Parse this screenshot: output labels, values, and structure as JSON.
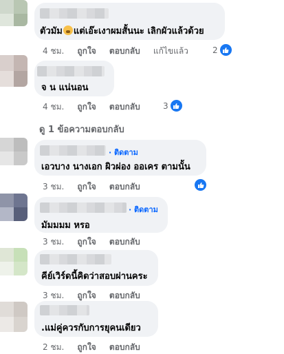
{
  "comments": [
    {
      "text_before": "ตัวมัม",
      "text_after": "แต่เอ๊ะเงาผมสั้นนะ เลิกผัวแล้วด้วย",
      "time": "4 ชม.",
      "like": "ถูกใจ",
      "reply": "ตอบกลับ",
      "edited": "แก้ไขแล้ว",
      "reactions": "2"
    },
    {
      "text": "จ น แน่นอน",
      "time": "4 ชม.",
      "like": "ถูกใจ",
      "reply": "ตอบกลับ",
      "reactions": "3"
    },
    {
      "follow": "· ติดตาม",
      "text": "เอวบาง นางเอก ผิวผ่อง ออเคร ตามนั้น",
      "time": "3 ชม.",
      "like": "ถูกใจ",
      "reply": "ตอบกลับ"
    },
    {
      "follow": "· ติดตาม",
      "text": "มัมมมม หรอ",
      "time": "3 ชม.",
      "like": "ถูกใจ",
      "reply": "ตอบกลับ"
    },
    {
      "text": "คีย์เวิร์ดนี้คิดว่าสอบผ่านคระ",
      "time": "3 ชม.",
      "like": "ถูกใจ",
      "reply": "ตอบกลับ"
    },
    {
      "text": ".แม่คู่ควรกับการยุคนเดียว",
      "time": "2 ชม.",
      "like": "ถูกใจ",
      "reply": "ตอบกลับ"
    }
  ],
  "view_replies": "ดู 1 ข้อความตอบกลับ",
  "icons": {
    "reaction": "like-thumb-icon",
    "emoji": "grimacing-face-emoji-icon"
  },
  "colors": {
    "bubble": "#f0f2f5",
    "accent": "#0866ff",
    "like": "#1877f2",
    "meta": "#65676b"
  }
}
